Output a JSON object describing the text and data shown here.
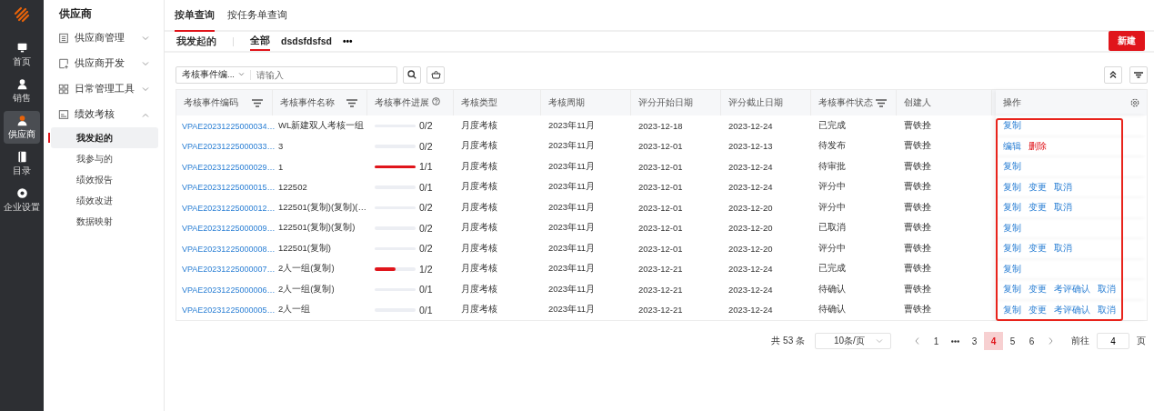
{
  "rail": {
    "items": [
      {
        "label": "首页",
        "selected": false
      },
      {
        "label": "销售",
        "selected": false
      },
      {
        "label": "供应商",
        "selected": true
      },
      {
        "label": "目录",
        "selected": false
      },
      {
        "label": "企业设置",
        "selected": false
      }
    ]
  },
  "sidebar": {
    "title": "供应商",
    "items": [
      {
        "label": "供应商管理",
        "expanded": false
      },
      {
        "label": "供应商开发",
        "expanded": false
      },
      {
        "label": "日常管理工具",
        "expanded": false
      },
      {
        "label": "绩效考核",
        "expanded": true,
        "children": [
          {
            "label": "我发起的",
            "selected": true
          },
          {
            "label": "我参与的",
            "selected": false
          },
          {
            "label": "绩效报告",
            "selected": false
          },
          {
            "label": "绩效改进",
            "selected": false
          },
          {
            "label": "数据映射",
            "selected": false
          }
        ]
      }
    ]
  },
  "tabs": [
    {
      "label": "按单查询",
      "selected": true
    },
    {
      "label": "按任务单查询",
      "selected": false
    }
  ],
  "view_bar": {
    "title": "我发起的",
    "views": [
      {
        "label": "全部",
        "selected": true
      },
      {
        "label": "dsdsfdsfsd",
        "selected": false
      }
    ],
    "more": "•••",
    "new_button": "新建"
  },
  "search": {
    "field_select": "考核事件编...",
    "placeholder": "请输入"
  },
  "table": {
    "columns": [
      {
        "label": "考核事件编码",
        "filterable": true,
        "help": false
      },
      {
        "label": "考核事件名称",
        "filterable": true,
        "help": false
      },
      {
        "label": "考核事件进展",
        "filterable": false,
        "help": true
      },
      {
        "label": "考核类型",
        "filterable": false,
        "help": false
      },
      {
        "label": "考核周期",
        "filterable": false,
        "help": false
      },
      {
        "label": "评分开始日期",
        "filterable": false,
        "help": false
      },
      {
        "label": "评分截止日期",
        "filterable": false,
        "help": false
      },
      {
        "label": "考核事件状态",
        "filterable": true,
        "help": false
      },
      {
        "label": "创建人",
        "filterable": false,
        "help": false
      },
      {
        "label": "操作",
        "filterable": false,
        "help": false
      }
    ],
    "rows": [
      {
        "code": "VPAE20231225000034…",
        "name": "WL新建双人考核一组",
        "level": 0,
        "progress": "0/2",
        "type": "月度考核",
        "period": "2023年11月",
        "start": "2023-12-18",
        "end": "2023-12-24",
        "status": "已完成",
        "creator": "曹铁拴",
        "actions": [
          {
            "label": "复制",
            "kind": "normal"
          }
        ]
      },
      {
        "code": "VPAE20231225000033…",
        "name": "3",
        "level": 0,
        "progress": "0/2",
        "type": "月度考核",
        "period": "2023年11月",
        "start": "2023-12-01",
        "end": "2023-12-13",
        "status": "待发布",
        "creator": "曹铁拴",
        "actions": [
          {
            "label": "编辑",
            "kind": "normal"
          },
          {
            "label": "删除",
            "kind": "danger"
          }
        ]
      },
      {
        "code": "VPAE20231225000029…",
        "name": "1",
        "level": 1,
        "progress": "1/1",
        "type": "月度考核",
        "period": "2023年11月",
        "start": "2023-12-01",
        "end": "2023-12-24",
        "status": "待审批",
        "creator": "曹铁拴",
        "actions": [
          {
            "label": "复制",
            "kind": "normal"
          }
        ]
      },
      {
        "code": "VPAE20231225000015…",
        "name": "122502",
        "level": 0,
        "progress": "0/1",
        "type": "月度考核",
        "period": "2023年11月",
        "start": "2023-12-01",
        "end": "2023-12-24",
        "status": "评分中",
        "creator": "曹铁拴",
        "actions": [
          {
            "label": "复制",
            "kind": "normal"
          },
          {
            "label": "变更",
            "kind": "normal"
          },
          {
            "label": "取消",
            "kind": "normal"
          }
        ]
      },
      {
        "code": "VPAE20231225000012…",
        "name": "122501(复制)(复制)(…",
        "level": 0,
        "progress": "0/2",
        "type": "月度考核",
        "period": "2023年11月",
        "start": "2023-12-01",
        "end": "2023-12-20",
        "status": "评分中",
        "creator": "曹铁拴",
        "actions": [
          {
            "label": "复制",
            "kind": "normal"
          },
          {
            "label": "变更",
            "kind": "normal"
          },
          {
            "label": "取消",
            "kind": "normal"
          }
        ]
      },
      {
        "code": "VPAE20231225000009…",
        "name": "122501(复制)(复制)",
        "level": 0,
        "progress": "0/2",
        "type": "月度考核",
        "period": "2023年11月",
        "start": "2023-12-01",
        "end": "2023-12-20",
        "status": "已取消",
        "creator": "曹铁拴",
        "actions": [
          {
            "label": "复制",
            "kind": "normal"
          }
        ]
      },
      {
        "code": "VPAE20231225000008…",
        "name": "122501(复制)",
        "level": 0,
        "progress": "0/2",
        "type": "月度考核",
        "period": "2023年11月",
        "start": "2023-12-01",
        "end": "2023-12-20",
        "status": "评分中",
        "creator": "曹铁拴",
        "actions": [
          {
            "label": "复制",
            "kind": "normal"
          },
          {
            "label": "变更",
            "kind": "normal"
          },
          {
            "label": "取消",
            "kind": "normal"
          }
        ]
      },
      {
        "code": "VPAE20231225000007…",
        "name": "2人一组(复制)",
        "level": 0.5,
        "progress": "1/2",
        "type": "月度考核",
        "period": "2023年11月",
        "start": "2023-12-21",
        "end": "2023-12-24",
        "status": "已完成",
        "creator": "曹铁拴",
        "actions": [
          {
            "label": "复制",
            "kind": "normal"
          }
        ]
      },
      {
        "code": "VPAE20231225000006…",
        "name": "2人一组(复制)",
        "level": 0,
        "progress": "0/1",
        "type": "月度考核",
        "period": "2023年11月",
        "start": "2023-12-21",
        "end": "2023-12-24",
        "status": "待确认",
        "creator": "曹铁拴",
        "actions": [
          {
            "label": "复制",
            "kind": "normal"
          },
          {
            "label": "变更",
            "kind": "normal"
          },
          {
            "label": "考评确认",
            "kind": "normal"
          },
          {
            "label": "取消",
            "kind": "normal"
          }
        ]
      },
      {
        "code": "VPAE20231225000005…",
        "name": "2人一组",
        "level": 0,
        "progress": "0/1",
        "type": "月度考核",
        "period": "2023年11月",
        "start": "2023-12-21",
        "end": "2023-12-24",
        "status": "待确认",
        "creator": "曹铁拴",
        "actions": [
          {
            "label": "复制",
            "kind": "normal"
          },
          {
            "label": "变更",
            "kind": "normal"
          },
          {
            "label": "考评确认",
            "kind": "normal"
          },
          {
            "label": "取消",
            "kind": "normal"
          }
        ]
      }
    ]
  },
  "pagination": {
    "total": "共 53 条",
    "page_size": "10条/页",
    "pages": [
      {
        "label": "1",
        "kind": "page",
        "selected": false
      },
      {
        "kind": "ellipsis",
        "selected": false
      },
      {
        "label": "3",
        "kind": "page",
        "selected": false
      },
      {
        "label": "4",
        "kind": "page",
        "selected": true
      },
      {
        "label": "5",
        "kind": "page",
        "selected": false
      },
      {
        "label": "6",
        "kind": "page",
        "selected": false
      }
    ],
    "goto_label": "前往",
    "goto_value": "4",
    "goto_suffix": "页"
  }
}
